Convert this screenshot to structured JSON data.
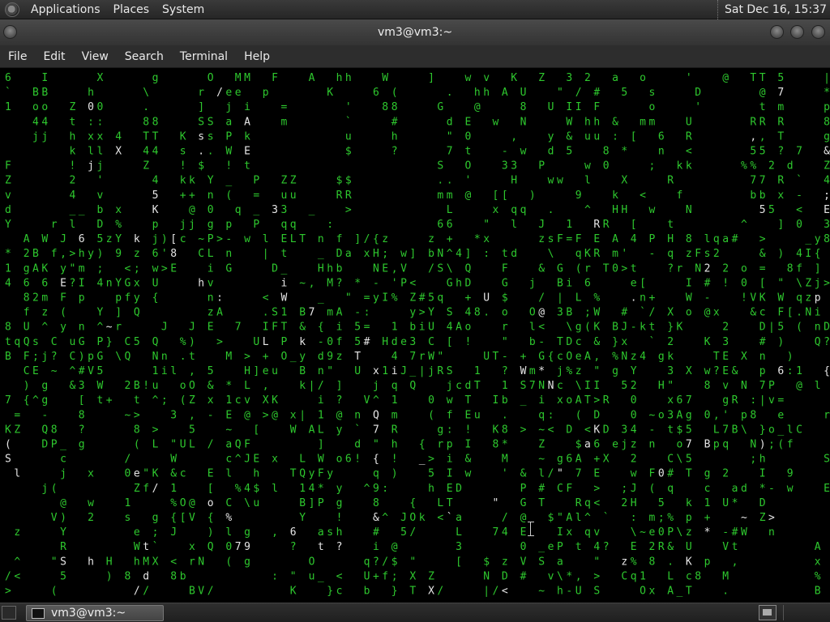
{
  "top_panel": {
    "menus": [
      "Applications",
      "Places",
      "System"
    ],
    "clock": "Sat Dec 16, 15:37"
  },
  "window": {
    "title": "vm3@vm3:~"
  },
  "menubar": {
    "items": [
      "File",
      "Edit",
      "View",
      "Search",
      "Terminal",
      "Help"
    ]
  },
  "taskbar": {
    "task_label": "vm3@vm3:~"
  },
  "colors": {
    "matrix_green": "#2ec82e",
    "matrix_white": "#e6e6e6",
    "panel_bg": "#2d2d2d"
  },
  "terminal": {
    "rain_rows": [
      "6  I    X    g    O  M  F  A  h   W   ]  w v K  Z 3 2 a  o   '  @  T 5   |",
      "`  B    h    \\    r /e  p     K   6 (    .  h A U  \" / # 5  s   D     @ 7   *",
      "1  o  Z 0    .    ] j i  =     '   8    G  @   8  U I F    o   '     t m   p",
      "   4  t :    8    S a A  m     `   #    d E w  N   W h &  m   U     R R   8",
      "   j  h x 4  T  K s P k        u   h    \" 0   ,  y & u : [ 6  R     , T   g",
      "      k l X  4  s . W E        $   ?    7 t  - w d 5  8 *  n  <     5 ? 7 &",
      "F     ! j    Z  ! $ ! t                 S O   3  P   w 0   ;  k     % 2 d  Z",
      "Z     2 '    4  k Y _ P  Z    $        . '   H   w  l  X   R       7 R ` 4",
      "v     4 v    5  + n ( =  u    R        m @  [  )   9  k  <  f      b x - ;",
      "d     _ b x  K  @ 0 q _ 3  _  >        L   x q  .  ^  H  w  N      5  < E",
      "Y   r l D %  p  j g p P  q   :         6   \" l  J 1  R  [  t      ^  ] 0 3"
    ]
  }
}
